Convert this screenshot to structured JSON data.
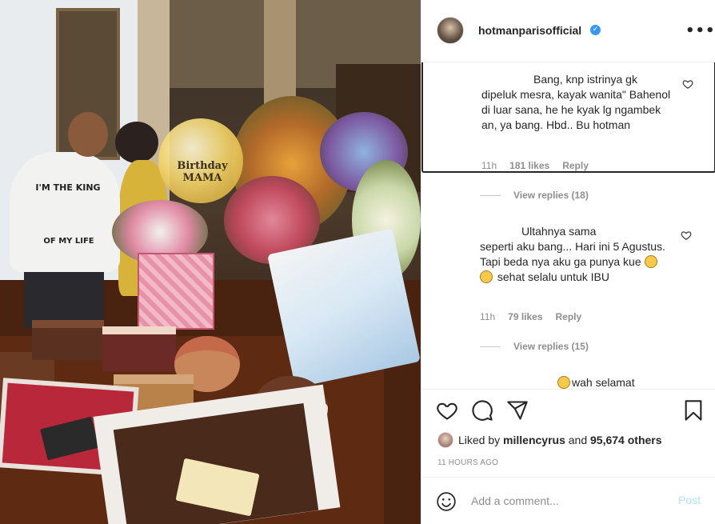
{
  "photo": {
    "alt_shirt_top": "I'M THE KING",
    "alt_shirt_bottom": "OF MY LIFE",
    "balloon_text": "Birthday MAMA"
  },
  "post": {
    "username": "hotmanparisofficial",
    "verified_mark": "✓",
    "more_label": "•••"
  },
  "comments": [
    {
      "text_line1": "Bang, knp istrinya gk",
      "text_rest": "dipeluk mesra, kayak wanita\" Bahenol di luar sana, he he kyak lg ngambek an, ya bang. Hbd.. Bu hotman",
      "time": "11h",
      "likes": "181 likes",
      "reply_label": "Reply",
      "view_replies": "View replies (18)"
    },
    {
      "text_line1": "Ultahnya sama",
      "text_rest": "seperti aku bang... Hari ini 5 Agustus. Tapi beda nya aku ga punya kue",
      "text_tail": "sehat selalu untuk IBU",
      "time": "11h",
      "likes": "79 likes",
      "reply_label": "Reply",
      "view_replies": "View replies (15)"
    },
    {
      "text_line1": "wah selamat"
    }
  ],
  "liked_by": {
    "prefix": "Liked by",
    "user": "millencyrus",
    "conj": "and",
    "others": "95,674 others"
  },
  "timestamp": "11 HOURS AGO",
  "add_comment": {
    "placeholder": "Add a comment...",
    "post_label": "Post"
  },
  "colors": {
    "verified": "#3897f0",
    "post_disabled": "#b2dffc",
    "muted": "#8e8e8e",
    "text": "#262626"
  },
  "icons": [
    "heart-icon",
    "comment-icon",
    "share-icon",
    "bookmark-icon",
    "smile-icon",
    "more-icon",
    "verified-icon"
  ]
}
